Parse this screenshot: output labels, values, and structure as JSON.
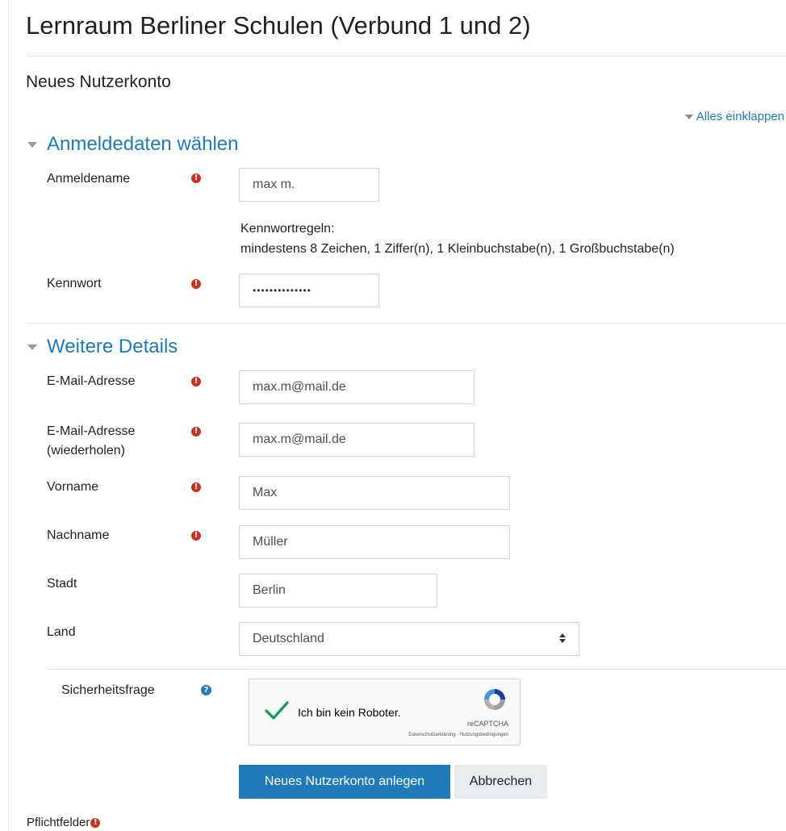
{
  "header": {
    "site_title": "Lernraum Berliner Schulen (Verbund 1 und 2)"
  },
  "page": {
    "heading": "Neues Nutzerkonto",
    "collapse_all": "Alles einklappen"
  },
  "sections": {
    "login": {
      "title": "Anmeldedaten wählen"
    },
    "details": {
      "title": "Weitere Details"
    }
  },
  "fields": {
    "username": {
      "label": "Anmeldename",
      "value": "max m."
    },
    "password_rules": {
      "title": "Kennwortregeln:",
      "text": "mindestens 8 Zeichen, 1 Ziffer(n), 1 Kleinbuchstabe(n), 1 Großbuchstabe(n)"
    },
    "password": {
      "label": "Kennwort",
      "value": "••••••••••••••"
    },
    "email": {
      "label": "E-Mail-Adresse",
      "value": "max.m@mail.de"
    },
    "email_repeat": {
      "label_line1": "E-Mail-Adresse",
      "label_line2": "(wiederholen)",
      "value": "max.m@mail.de"
    },
    "firstname": {
      "label": "Vorname",
      "value": "Max"
    },
    "lastname": {
      "label": "Nachname",
      "value": "Müller"
    },
    "city": {
      "label": "Stadt",
      "value": "Berlin"
    },
    "country": {
      "label": "Land",
      "value": "Deutschland"
    },
    "security": {
      "label": "Sicherheitsfrage"
    }
  },
  "recaptcha": {
    "checkbox_label": "Ich bin kein Roboter.",
    "brand": "reCAPTCHA",
    "terms": "Datenschutzerklärung - Nutzungsbedingungen"
  },
  "buttons": {
    "submit": "Neues Nutzerkonto anlegen",
    "cancel": "Abbrechen"
  },
  "footer": {
    "required_note": "Pflichtfelder"
  },
  "icons": {
    "required": "exclamation-circle-icon",
    "help": "question-circle-icon",
    "collapse": "caret-down-icon"
  },
  "colors": {
    "link": "#1f7bb8",
    "required": "#ca3120",
    "primary_button": "#1f7bb8",
    "secondary_button": "#e9ecef"
  }
}
